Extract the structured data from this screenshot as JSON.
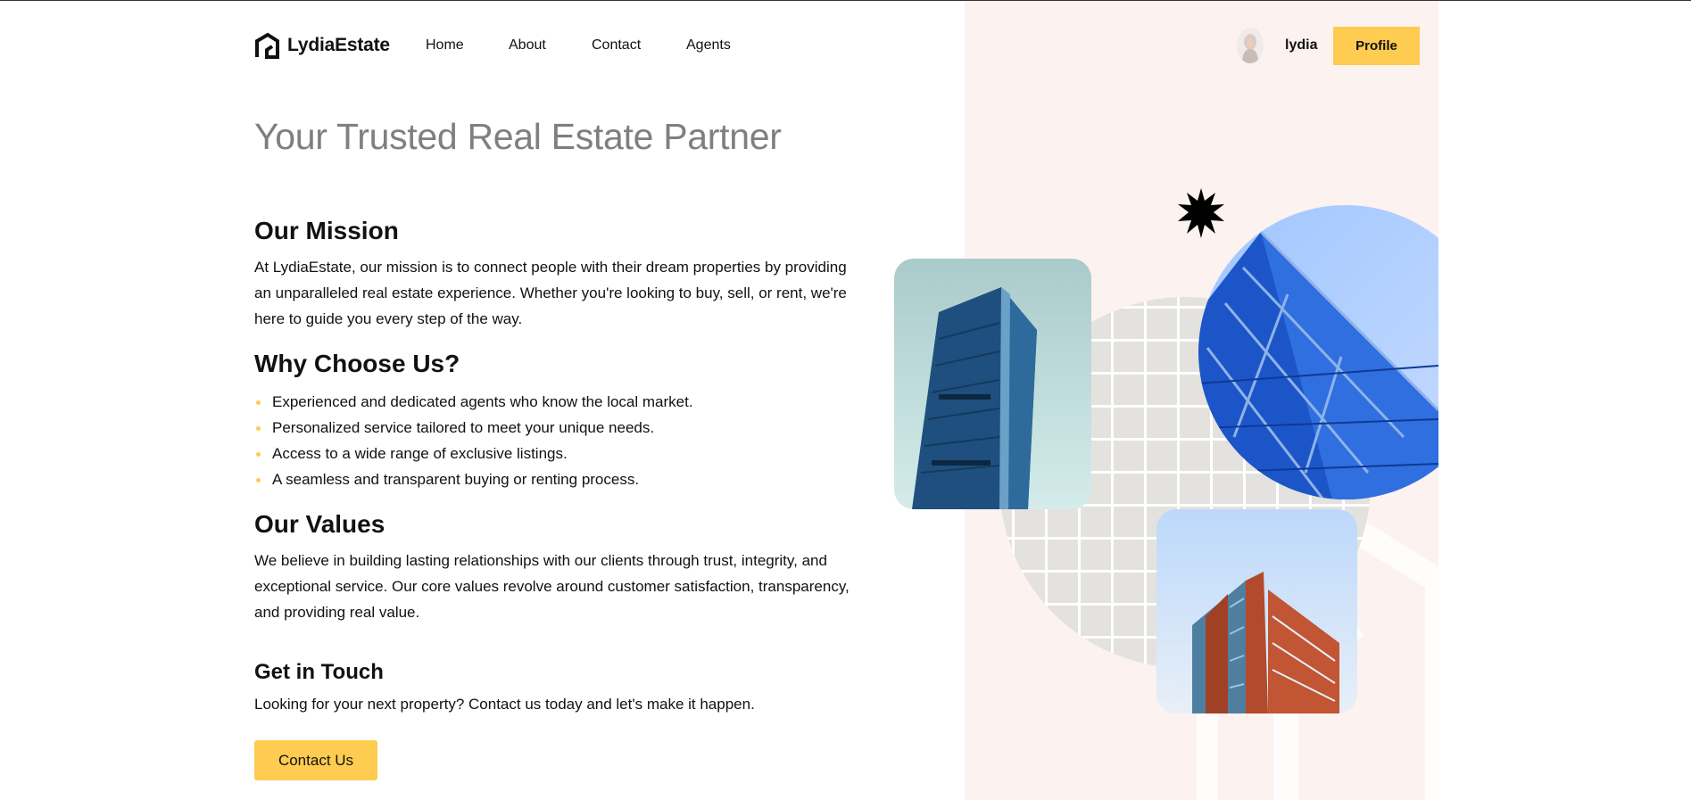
{
  "brand": {
    "name": "LydiaEstate",
    "accent": "#fdcc50"
  },
  "nav": {
    "items": [
      "Home",
      "About",
      "Contact",
      "Agents"
    ]
  },
  "user": {
    "name": "lydia",
    "profile_label": "Profile"
  },
  "hero": {
    "title": "Your Trusted Real Estate Partner"
  },
  "mission": {
    "heading": "Our Mission",
    "text": "At LydiaEstate, our mission is to connect people with their dream properties by providing an unparalleled real estate experience. Whether you're looking to buy, sell, or rent, we're here to guide you every step of the way."
  },
  "why": {
    "heading": "Why Choose Us?",
    "items": [
      "Experienced and dedicated agents who know the local market.",
      "Personalized service tailored to meet your unique needs.",
      "Access to a wide range of exclusive listings.",
      "A seamless and transparent buying or renting process."
    ]
  },
  "values": {
    "heading": "Our Values",
    "text": "We believe in building lasting relationships with our clients through trust, integrity, and exceptional service. Our core values revolve around customer satisfaction, transparency, and providing real value."
  },
  "contact": {
    "heading": "Get in Touch",
    "text": "Looking for your next property? Contact us today and let's make it happen.",
    "button_label": "Contact Us"
  },
  "icons": {
    "logo": "house-logo-icon",
    "decor": "starburst-icon"
  },
  "colors": {
    "panel_bg": "#fcf2f0",
    "title_gray": "#7f7f7f",
    "bullet": "#fdcc50"
  }
}
